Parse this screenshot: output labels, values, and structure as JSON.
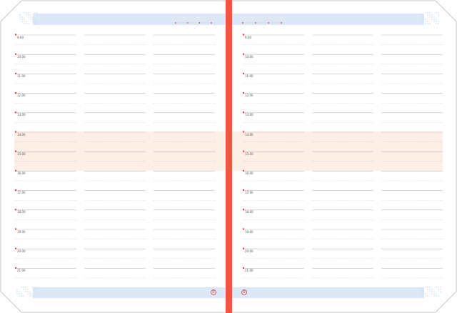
{
  "planner": {
    "hours": [
      "9:00",
      "10:00",
      "11:00",
      "12:00",
      "13:00",
      "14:00",
      "15:00",
      "16:00",
      "17:00",
      "18:00",
      "19:00",
      "20:00",
      "21:00"
    ],
    "lunch_hours": [
      "14:00",
      "15:00"
    ],
    "left_page_number": "0",
    "right_page_number": "0"
  },
  "colors": {
    "spine": "#e8593f",
    "header_band": "#dde8f7",
    "highlight_band": "#fdeee6",
    "rule_line": "#bbbbbb",
    "marker": "#d9363e",
    "outline": "#c8c8c8",
    "dot_pattern": "#c6d8f0"
  }
}
